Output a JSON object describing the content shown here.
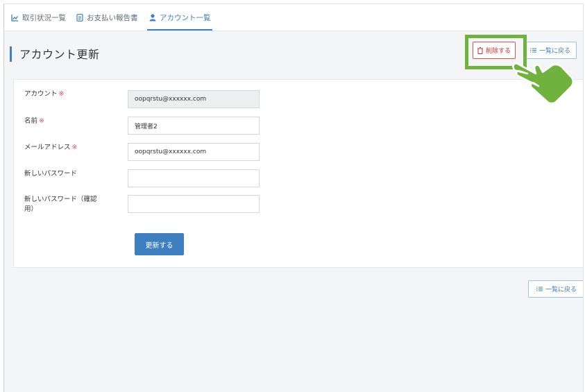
{
  "nav": {
    "items": [
      {
        "label": "取引状況一覧",
        "icon": "chart-icon"
      },
      {
        "label": "お支払い報告書",
        "icon": "document-icon"
      },
      {
        "label": "アカウント一覧",
        "icon": "user-icon",
        "active": true
      }
    ]
  },
  "header": {
    "title": "アカウント更新",
    "delete_label": "削除する",
    "back_label": "一覧に戻る"
  },
  "form": {
    "account": {
      "label": "アカウント",
      "required_mark": "※",
      "value": "oopqrstu@xxxxxx.com"
    },
    "name": {
      "label": "名前",
      "required_mark": "※",
      "value": "管理者2"
    },
    "email": {
      "label": "メールアドレス",
      "required_mark": "※",
      "value": "oopqrstu@xxxxxx.com"
    },
    "new_password": {
      "label": "新しいパスワード",
      "value": ""
    },
    "confirm_password": {
      "label": "新しいパスワード（確認用）",
      "value": ""
    },
    "submit_label": "更新する"
  },
  "footer": {
    "back_label": "一覧に戻る"
  },
  "colors": {
    "accent": "#3d7fc0",
    "danger": "#d9534f",
    "highlight": "#6fb33e"
  }
}
